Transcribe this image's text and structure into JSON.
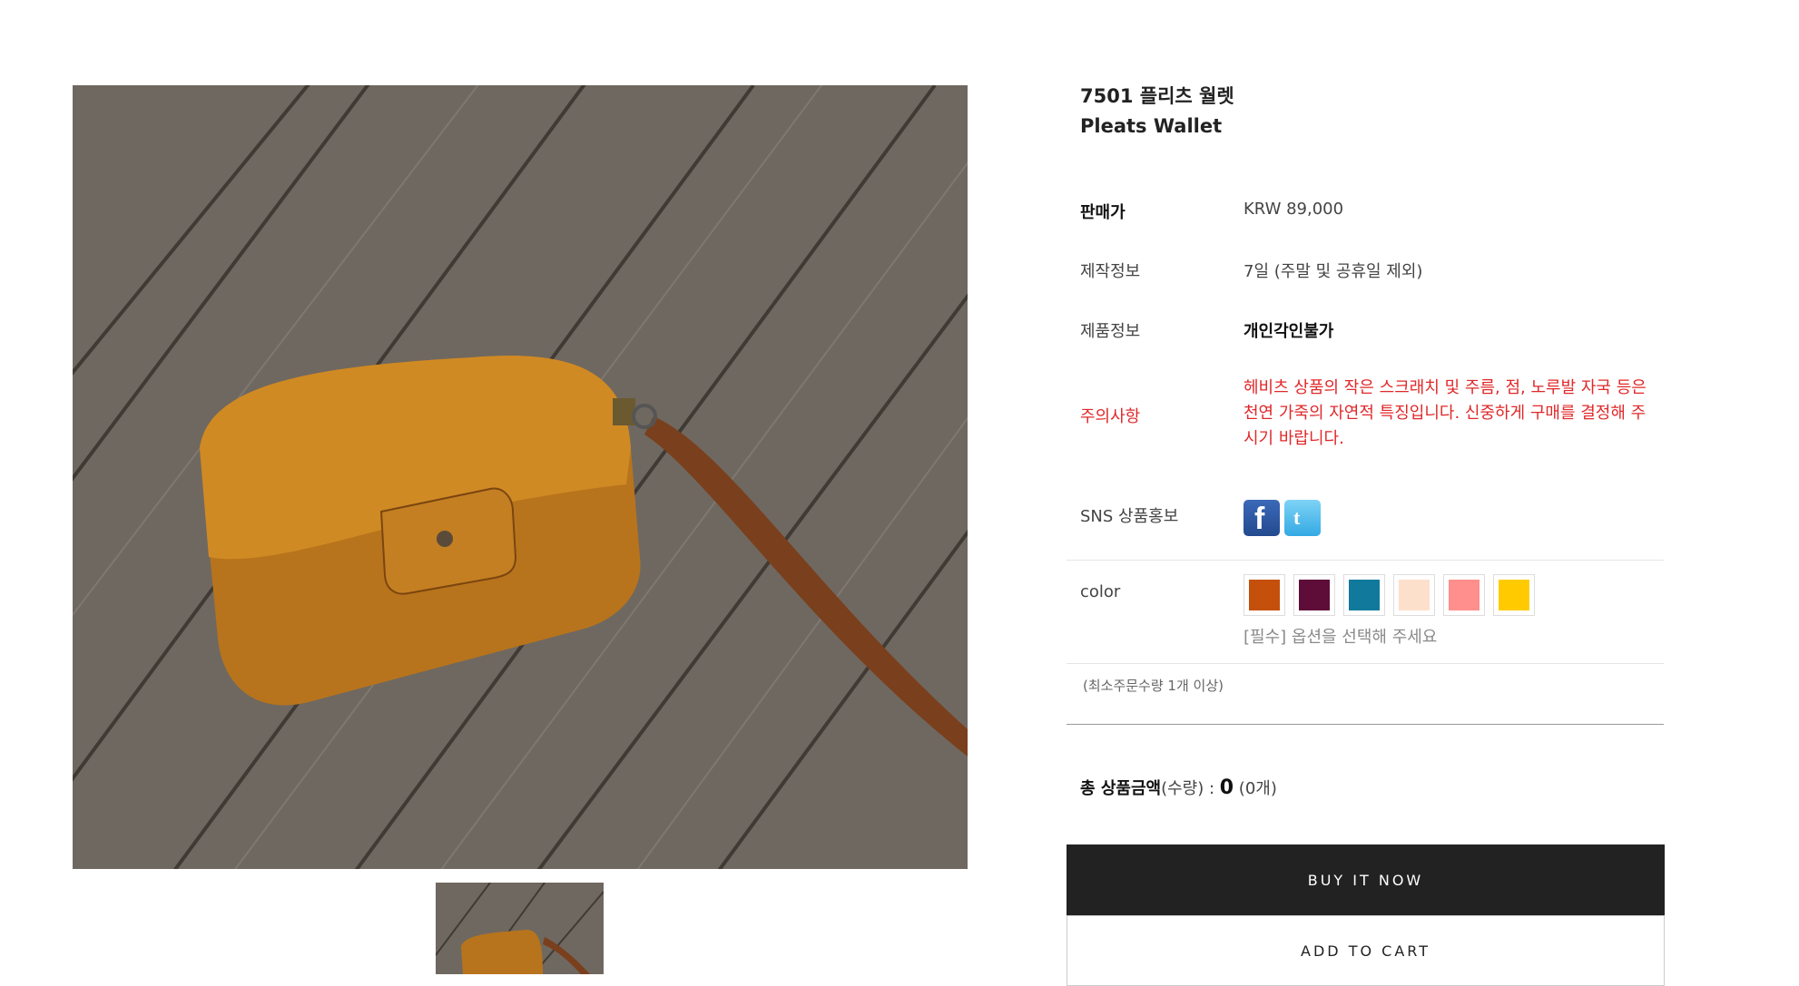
{
  "product": {
    "title_ko": "7501 플리츠 월렛",
    "title_en": "Pleats Wallet"
  },
  "details": {
    "price_label": "판매가",
    "price_value": "KRW 89,000",
    "production_label": "제작정보",
    "production_value": "7일 (주말 및 공휴일 제외)",
    "info_label": "제품정보",
    "info_value": "개인각인불가",
    "notice_label": "주의사항",
    "notice_value": "헤비츠 상품의 작은 스크래치 및 주름, 점, 노루발 자국 등은 천연 가죽의 자연적 특징입니다. 신중하게 구매를 결정해 주시기 바랍니다.",
    "sns_label": "SNS 상품홍보",
    "facebook_icon": "facebook-icon",
    "twitter_icon": "twitter-icon"
  },
  "options": {
    "color_label": "color",
    "swatches": [
      "#c4500c",
      "#5e0c38",
      "#117a9c",
      "#fde0cc",
      "#fe8f8d",
      "#ffcb00"
    ],
    "required_text": "[필수] 옵션을 선택해 주세요",
    "min_qty_text": "(최소주문수량 1개 이상)"
  },
  "total": {
    "label": "총 상품금액",
    "qty_label": "(수량) : ",
    "amount": "0",
    "count": " (0개)"
  },
  "actions": {
    "buy_now": "BUY IT NOW",
    "add_to_cart": "ADD TO CART"
  }
}
